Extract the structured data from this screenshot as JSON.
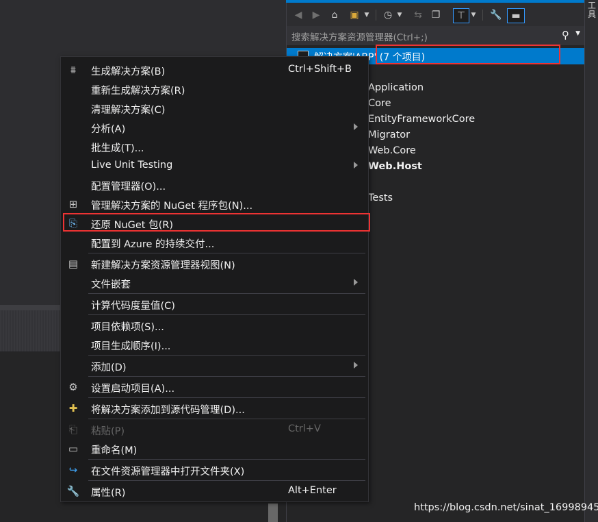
{
  "solution_explorer": {
    "search_placeholder": "搜索解决方案资源管理器(Ctrl+;)",
    "selected_item": "解决方案'ABP' (7 个项目)",
    "tree_items": [
      "Application",
      "Core",
      "EntityFrameworkCore",
      "Migrator",
      "Web.Core",
      "Web.Host",
      "Tests"
    ]
  },
  "right_strip_label": "工具",
  "context_menu": {
    "items": [
      {
        "label": "生成解决方案(B)",
        "shortcut": "Ctrl+Shift+B",
        "icon": "build-icon"
      },
      {
        "label": "重新生成解决方案(R)"
      },
      {
        "label": "清理解决方案(C)"
      },
      {
        "label": "分析(A)",
        "submenu": true
      },
      {
        "label": "批生成(T)..."
      },
      {
        "label": "Live Unit Testing",
        "submenu": true
      },
      {
        "label": "配置管理器(O)..."
      },
      {
        "label": "管理解决方案的 NuGet 程序包(N)...",
        "icon": "nuget-package-icon"
      },
      {
        "label": "还原 NuGet 包(R)",
        "icon": "restore-icon"
      },
      {
        "label": "配置到 Azure 的持续交付..."
      },
      {
        "label": "新建解决方案资源管理器视图(N)",
        "icon": "new-view-icon"
      },
      {
        "label": "文件嵌套",
        "submenu": true
      },
      {
        "label": "计算代码度量值(C)"
      },
      {
        "label": "项目依赖项(S)..."
      },
      {
        "label": "项目生成顺序(I)..."
      },
      {
        "label": "添加(D)",
        "submenu": true
      },
      {
        "label": "设置启动项目(A)...",
        "icon": "gear-icon"
      },
      {
        "label": "将解决方案添加到源代码管理(D)...",
        "icon": "source-control-icon"
      },
      {
        "label": "粘贴(P)",
        "shortcut": "Ctrl+V",
        "icon": "paste-icon",
        "disabled": true
      },
      {
        "label": "重命名(M)",
        "icon": "rename-icon"
      },
      {
        "label": "在文件资源管理器中打开文件夹(X)",
        "icon": "open-folder-icon"
      },
      {
        "label": "属性(R)",
        "shortcut": "Alt+Enter",
        "icon": "wrench-icon"
      }
    ]
  },
  "watermark": "https://blog.csdn.net/sinat_16998945",
  "colors": {
    "accent": "#007acc",
    "highlight_box": "#ee3333",
    "menu_bg": "#1b1b1c"
  }
}
